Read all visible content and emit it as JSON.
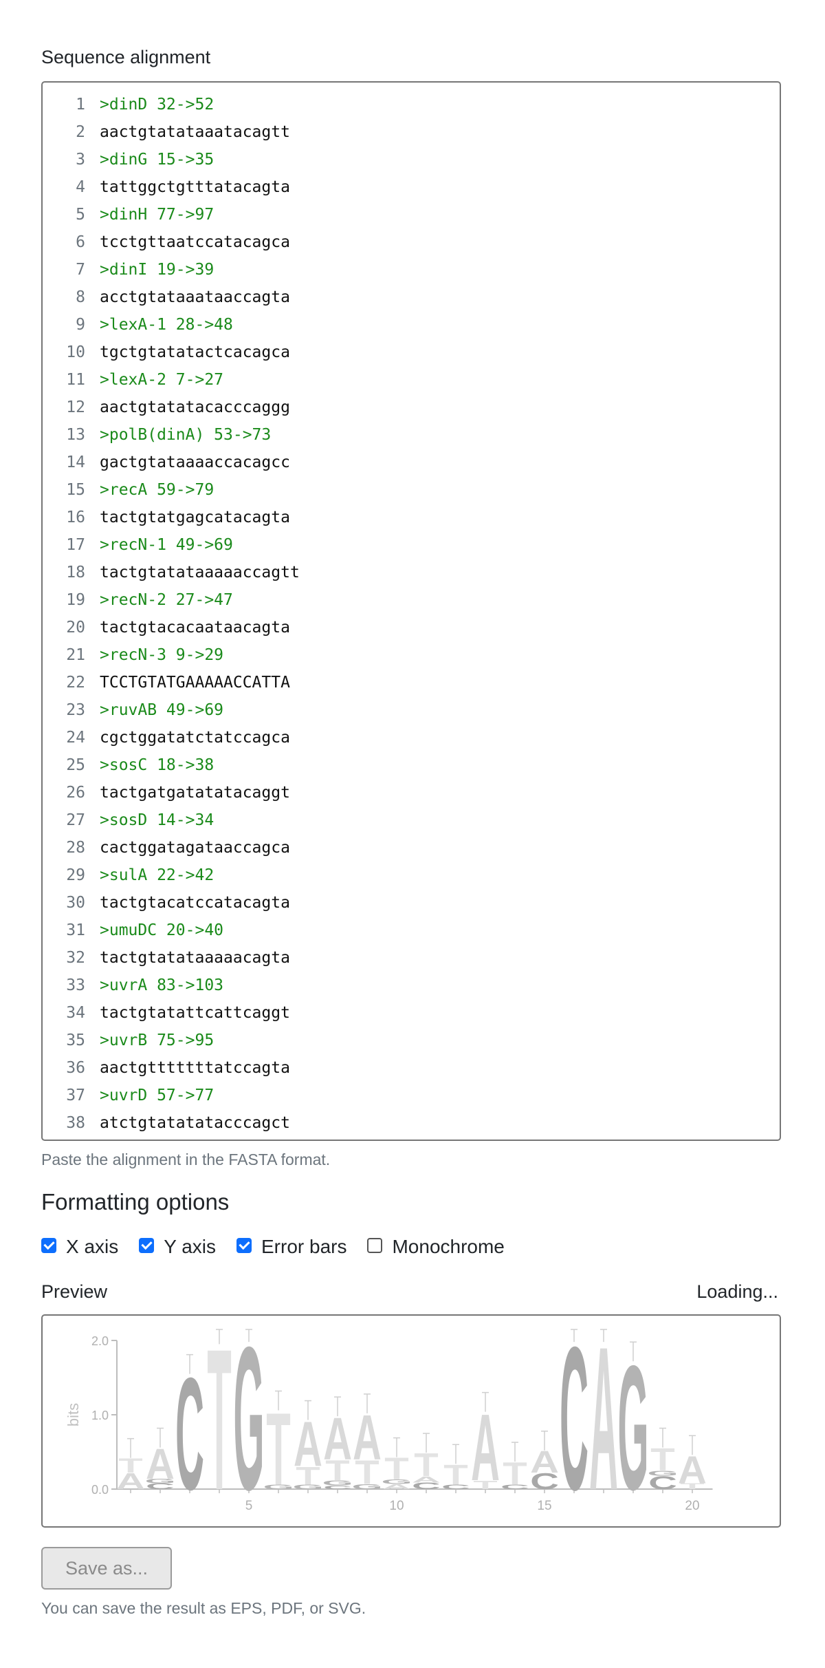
{
  "alignment": {
    "label": "Sequence alignment",
    "lines": [
      ">dinD 32->52",
      "aactgtatataaatacagtt",
      ">dinG 15->35",
      "tattggctgtttatacagta",
      ">dinH 77->97",
      "tcctgttaatccatacagca",
      ">dinI 19->39",
      "acctgtataaataaccagta",
      ">lexA-1 28->48",
      "tgctgtatatactcacagca",
      ">lexA-2 7->27",
      "aactgtatatacacccaggg",
      ">polB(dinA) 53->73",
      "gactgtataaaaccacagcc",
      ">recA 59->79",
      "tactgtatgagcatacagta",
      ">recN-1 49->69",
      "tactgtatataaaaaccagtt",
      ">recN-2 27->47",
      "tactgtacacaataacagta",
      ">recN-3 9->29",
      "TCCTGTATGAAAAACCATTA",
      ">ruvAB 49->69",
      "cgctggatatctatccagca",
      ">sosC 18->38",
      "tactgatgatatatacaggt",
      ">sosD 14->34",
      "cactggatagataaccagca",
      ">sulA 22->42",
      "tactgtacatccatacagta",
      ">umuDC 20->40",
      "tactgtatataaaaacagta",
      ">uvrA 83->103",
      "tactgtatattcattcaggt",
      ">uvrB 75->95",
      "aactgtttttttatccagta",
      ">uvrD 57->77",
      "atctgtatatatacccagct"
    ],
    "help": "Paste the alignment in the FASTA format."
  },
  "formatting": {
    "heading": "Formatting options",
    "options": [
      {
        "label": "X axis",
        "checked": true
      },
      {
        "label": "Y axis",
        "checked": true
      },
      {
        "label": "Error bars",
        "checked": true
      },
      {
        "label": "Monochrome",
        "checked": false
      }
    ]
  },
  "preview": {
    "label": "Preview",
    "status": "Loading...",
    "logo": {
      "ylabel": "bits",
      "y_ticks": [
        "0.0",
        "1.0",
        "2.0"
      ],
      "x_ticks": [
        "5",
        "10",
        "15",
        "20"
      ],
      "positions": [
        [
          [
            "A",
            0.22
          ],
          [
            "T",
            0.2
          ]
        ],
        [
          [
            "C",
            0.08
          ],
          [
            "G",
            0.06
          ],
          [
            "A",
            0.42
          ]
        ],
        [
          [
            "C",
            1.55
          ]
        ],
        [
          [
            "T",
            1.95
          ]
        ],
        [
          [
            "G",
            1.98
          ]
        ],
        [
          [
            "G",
            0.06
          ],
          [
            "T",
            1.0
          ]
        ],
        [
          [
            "G",
            0.06
          ],
          [
            "T",
            0.25
          ],
          [
            "A",
            0.62
          ]
        ],
        [
          [
            "C",
            0.05
          ],
          [
            "G",
            0.07
          ],
          [
            "T",
            0.28
          ],
          [
            "A",
            0.58
          ]
        ],
        [
          [
            "G",
            0.07
          ],
          [
            "T",
            0.33
          ],
          [
            "A",
            0.62
          ]
        ],
        [
          [
            "A",
            0.07
          ],
          [
            "G",
            0.06
          ],
          [
            "T",
            0.3
          ]
        ],
        [
          [
            "C",
            0.09
          ],
          [
            "A",
            0.08
          ],
          [
            "T",
            0.32
          ]
        ],
        [
          [
            "C",
            0.06
          ],
          [
            "T",
            0.28
          ]
        ],
        [
          [
            "T",
            0.12
          ],
          [
            "A",
            0.92
          ]
        ],
        [
          [
            "C",
            0.06
          ],
          [
            "T",
            0.31
          ]
        ],
        [
          [
            "C",
            0.22
          ],
          [
            "A",
            0.3
          ]
        ],
        [
          [
            "C",
            1.98
          ]
        ],
        [
          [
            "A",
            1.98
          ]
        ],
        [
          [
            "G",
            1.72
          ]
        ],
        [
          [
            "C",
            0.18
          ],
          [
            "G",
            0.07
          ],
          [
            "T",
            0.31
          ]
        ],
        [
          [
            "T",
            0.08
          ],
          [
            "A",
            0.38
          ]
        ]
      ]
    }
  },
  "save": {
    "button": "Save as...",
    "help": "You can save the result as EPS, PDF, or SVG."
  }
}
